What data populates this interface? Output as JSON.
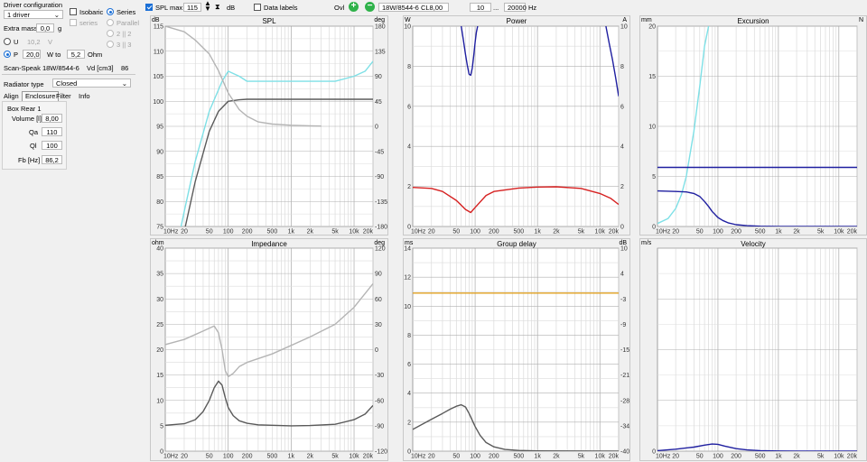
{
  "driver_config": {
    "title": "Driver configuration",
    "driver_count": "1 driver",
    "isobaric_label": "Isobaric",
    "series_label": "Series",
    "series_dim_label": "series",
    "parallel_label": "Parallel",
    "two_two_label": "2 || 2",
    "three_three_label": "3 || 3",
    "extra_mass_label": "Extra mass",
    "extra_mass_value": "0,0",
    "extra_mass_unit": "g",
    "u_label": "U",
    "u_value": "10,2",
    "u_unit": "V",
    "p_label": "P",
    "p_value": "20,0",
    "w_to_label": "W to",
    "ohm_value": "5,2",
    "ohm_unit": "Ohm",
    "driver_name": "Scan-Speak 18W/8544-6",
    "vd_label": "Vd [cm3]",
    "vd_value": "86"
  },
  "radiator": {
    "label": "Radiator type",
    "value": "Closed"
  },
  "tabs": [
    {
      "label": "Align"
    },
    {
      "label": "Enclosure"
    },
    {
      "label": "Filter"
    },
    {
      "label": "Info"
    }
  ],
  "box": {
    "title": "Box Rear 1",
    "fields": [
      {
        "label": "Volume [l]",
        "value": "8,00"
      },
      {
        "label": "Qa",
        "value": "110"
      },
      {
        "label": "Ql",
        "value": "100"
      },
      {
        "label": "Fb [Hz]",
        "value": "86,2"
      }
    ]
  },
  "toolbar": {
    "spl_max_label": "SPL max",
    "spl_max_value": "115",
    "spl_unit": "dB",
    "data_labels": "Data labels",
    "ovl_label": "Ovl",
    "driver_select": "18W/8544-6 CL8,00",
    "freq_min": "10",
    "freq_sep": "...",
    "freq_max": "20000",
    "freq_unit": "Hz"
  },
  "colors": {
    "cyan": "#7ee0e6",
    "gray_dark": "#5a5a5a",
    "gray_light": "#b4b4b4",
    "navy": "#1f1fa0",
    "red": "#d62020",
    "orange": "#e0a020",
    "add_button": "#2fb24a",
    "remove_button": "#2fb24a"
  },
  "charts": [
    {
      "title": "SPL",
      "left_unit": "dB",
      "right_unit": "deg",
      "left_ticks": [
        "115",
        "110",
        "105",
        "100",
        "95",
        "90",
        "85",
        "80",
        "75"
      ],
      "right_ticks": [
        "180",
        "135",
        "90",
        "45",
        "0",
        "-45",
        "-90",
        "-135",
        "-180"
      ],
      "x_ticks": [
        "10Hz",
        "20",
        "50",
        "100",
        "200",
        "500",
        "1k",
        "2k",
        "5k",
        "10k",
        "20k"
      ],
      "chart_data": {
        "type": "line",
        "x_scale": "log",
        "xlim": [
          10,
          20000
        ],
        "ylim": [
          75,
          115
        ],
        "y2lim": [
          -180,
          180
        ],
        "series": [
          {
            "color": "cyan",
            "axis": "left",
            "x": [
              10,
              20,
              30,
              50,
              80,
              100,
              150,
              200,
              500,
              1000,
              2000,
              5000,
              10000,
              15000,
              20000
            ],
            "y": [
              60,
              78,
              88,
              98,
              104,
              106,
              105,
              104,
              104,
              104,
              104,
              104,
              105,
              106,
              108
            ]
          },
          {
            "color": "gray_dark",
            "axis": "left",
            "x": [
              10,
              20,
              30,
              50,
              70,
              100,
              150,
              200,
              500,
              1000,
              5000,
              20000
            ],
            "y": [
              55,
              74,
              84,
              94,
              98,
              100,
              100.3,
              100.4,
              100.4,
              100.4,
              100.4,
              100.4
            ]
          },
          {
            "color": "gray_light",
            "axis": "right",
            "x": [
              10,
              20,
              30,
              50,
              70,
              100,
              150,
              200,
              300,
              500,
              1000,
              2000,
              3000
            ],
            "y": [
              180,
              170,
              155,
              130,
              100,
              60,
              30,
              18,
              8,
              4,
              2,
              1,
              0.5
            ]
          }
        ]
      }
    },
    {
      "title": "Power",
      "left_unit": "W",
      "right_unit": "A",
      "left_ticks": [
        "10",
        "8",
        "6",
        "4",
        "2",
        "0"
      ],
      "right_ticks": [
        "10",
        "8",
        "6",
        "4",
        "2",
        "0"
      ],
      "x_ticks": [
        "10Hz",
        "20",
        "50",
        "100",
        "200",
        "500",
        "1k",
        "2k",
        "5k",
        "10k",
        "20k"
      ],
      "chart_data": {
        "type": "line",
        "x_scale": "log",
        "xlim": [
          10,
          20000
        ],
        "ylim": [
          0,
          10
        ],
        "series": [
          {
            "color": "navy",
            "x": [
              60,
              65,
              70,
              75,
              80,
              85,
              90,
              95,
              100,
              105,
              110
            ],
            "y": [
              10,
              9.3,
              8.6,
              8.05,
              7.6,
              7.55,
              7.9,
              8.5,
              9.2,
              9.7,
              10
            ]
          },
          {
            "color": "navy",
            "x": [
              12500,
              14000,
              16000,
              18000,
              20000
            ],
            "y": [
              10,
              9.2,
              8.3,
              7.4,
              6.5
            ]
          },
          {
            "color": "red",
            "x": [
              10,
              20,
              30,
              50,
              70,
              85,
              100,
              150,
              200,
              500,
              1000,
              2000,
              5000,
              10000,
              15000,
              20000
            ],
            "y": [
              1.95,
              1.9,
              1.75,
              1.3,
              0.85,
              0.7,
              0.95,
              1.55,
              1.75,
              1.92,
              1.97,
              1.98,
              1.9,
              1.65,
              1.4,
              1.1
            ]
          }
        ]
      }
    },
    {
      "title": "Excursion",
      "left_unit": "mm",
      "right_unit": "N",
      "left_ticks": [
        "20",
        "15",
        "10",
        "5",
        "0"
      ],
      "x_ticks": [
        "10Hz",
        "20",
        "50",
        "100",
        "200",
        "500",
        "1k",
        "2k",
        "5k",
        "10k",
        "20k"
      ],
      "chart_data": {
        "type": "line",
        "x_scale": "log",
        "xlim": [
          10,
          20000
        ],
        "ylim": [
          0,
          20
        ],
        "series": [
          {
            "color": "cyan",
            "x": [
              10,
              15,
              20,
              25,
              30,
              40,
              50,
              60,
              70
            ],
            "y": [
              0.3,
              0.8,
              1.8,
              3.2,
              5,
              9.5,
              14,
              18,
              20
            ]
          },
          {
            "color": "navy",
            "x": [
              10,
              20000
            ],
            "y": [
              5.9,
              5.9
            ]
          },
          {
            "color": "navy",
            "x": [
              10,
              20,
              30,
              40,
              50,
              60,
              70,
              80,
              100,
              120,
              150,
              200,
              300,
              500,
              1000,
              20000
            ],
            "y": [
              3.55,
              3.5,
              3.45,
              3.3,
              3,
              2.5,
              2,
              1.5,
              0.9,
              0.6,
              0.35,
              0.18,
              0.08,
              0.03,
              0.01,
              0
            ]
          }
        ]
      }
    },
    {
      "title": "Impedance",
      "left_unit": "ohm",
      "right_unit": "deg",
      "left_ticks": [
        "40",
        "35",
        "30",
        "25",
        "20",
        "15",
        "10",
        "5",
        "0"
      ],
      "right_ticks": [
        "120",
        "90",
        "60",
        "30",
        "0",
        "-30",
        "-60",
        "-90",
        "-120"
      ],
      "x_ticks": [
        "10Hz",
        "20",
        "50",
        "100",
        "200",
        "500",
        "1k",
        "2k",
        "5k",
        "10k",
        "20k"
      ],
      "chart_data": {
        "type": "line",
        "x_scale": "log",
        "xlim": [
          10,
          20000
        ],
        "ylim": [
          0,
          40
        ],
        "y2lim": [
          -120,
          120
        ],
        "series": [
          {
            "color": "gray_light",
            "axis": "right",
            "x": [
              10,
              20,
              40,
              60,
              70,
              80,
              90,
              100,
              120,
              150,
              200,
              500,
              1000,
              2000,
              5000,
              10000,
              20000
            ],
            "y": [
              6,
              12,
              22,
              28,
              20,
              0,
              -25,
              -32,
              -28,
              -20,
              -15,
              -5,
              5,
              15,
              30,
              50,
              78
            ]
          },
          {
            "color": "gray_dark",
            "axis": "left",
            "x": [
              10,
              20,
              30,
              40,
              50,
              60,
              70,
              80,
              90,
              100,
              120,
              150,
              200,
              300,
              500,
              1000,
              2000,
              5000,
              10000,
              15000,
              20000
            ],
            "y": [
              5.1,
              5.4,
              6.2,
              7.8,
              10,
              12.5,
              13.8,
              13,
              10.5,
              8.6,
              7,
              6,
              5.5,
              5.2,
              5.1,
              5,
              5.05,
              5.3,
              6.2,
              7.3,
              9
            ]
          }
        ]
      }
    },
    {
      "title": "Group delay",
      "left_unit": "ms",
      "right_unit": "dB",
      "left_ticks": [
        "14",
        "12",
        "10",
        "8",
        "6",
        "4",
        "2",
        "0"
      ],
      "right_ticks": [
        "10",
        "4",
        "-3",
        "-9",
        "-15",
        "-21",
        "-28",
        "-34",
        "-40"
      ],
      "x_ticks": [
        "10Hz",
        "20",
        "50",
        "100",
        "200",
        "500",
        "1k",
        "2k",
        "5k",
        "10k",
        "20k"
      ],
      "chart_data": {
        "type": "line",
        "x_scale": "log",
        "xlim": [
          10,
          20000
        ],
        "ylim": [
          0,
          14
        ],
        "series": [
          {
            "color": "orange",
            "x": [
              10,
              20000
            ],
            "y": [
              10.9,
              10.9
            ]
          },
          {
            "color": "gray_dark",
            "x": [
              10,
              20,
              30,
              40,
              50,
              60,
              70,
              80,
              100,
              120,
              150,
              200,
              300,
              500,
              1000,
              20000
            ],
            "y": [
              1.5,
              2.2,
              2.6,
              2.9,
              3.1,
              3.2,
              3.05,
              2.6,
              1.7,
              1.1,
              0.6,
              0.3,
              0.12,
              0.05,
              0.02,
              0
            ]
          }
        ]
      }
    },
    {
      "title": "Velocity",
      "left_unit": "m/s",
      "left_ticks": [
        "0"
      ],
      "x_ticks": [
        "10Hz",
        "20",
        "50",
        "100",
        "200",
        "500",
        "1k",
        "2k",
        "5k",
        "10k",
        "20k"
      ],
      "chart_data": {
        "type": "line",
        "x_scale": "log",
        "xlim": [
          10,
          20000
        ],
        "ylim": [
          0,
          40
        ],
        "series": [
          {
            "color": "navy",
            "x": [
              10,
              20,
              40,
              60,
              80,
              100,
              130,
              200,
              300,
              500,
              1000,
              2000,
              5000,
              10000,
              20000
            ],
            "y": [
              0.1,
              0.4,
              0.8,
              1.2,
              1.4,
              1.35,
              1,
              0.5,
              0.25,
              0.1,
              0.04,
              0.02,
              0.01,
              0.005,
              0
            ]
          }
        ]
      }
    }
  ]
}
